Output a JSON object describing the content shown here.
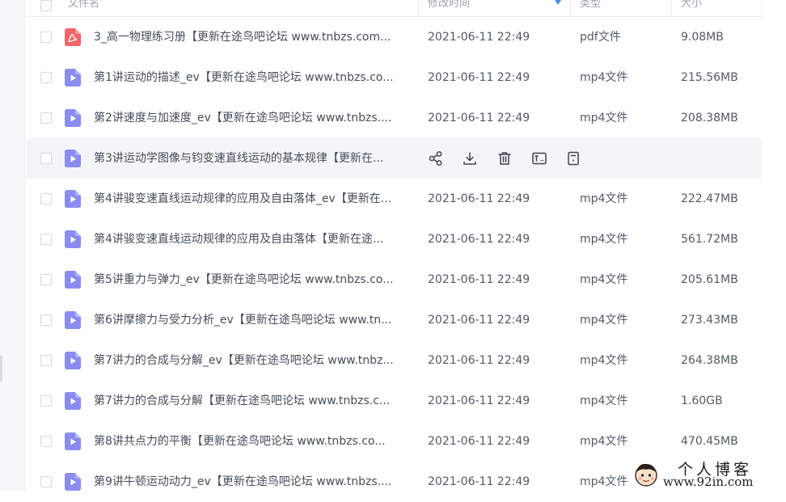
{
  "header": {
    "name_label": "文件名",
    "time_label": "修改时间",
    "type_label": "类型",
    "size_label": "大小"
  },
  "files": [
    {
      "name": "3_高一物理练习册【更新在途鸟吧论坛 www.tnbzs.com...",
      "time": "2021-06-11 22:49",
      "type": "pdf文件",
      "size": "9.08MB",
      "icon": "pdf-icon"
    },
    {
      "name": "第1讲运动的描述_ev【更新在途鸟吧论坛 www.tnbzs.co...",
      "time": "2021-06-11 22:49",
      "type": "mp4文件",
      "size": "215.56MB",
      "icon": "video-file-icon"
    },
    {
      "name": "第2讲速度与加速度_ev【更新在途鸟吧论坛 www.tnbzs....",
      "time": "2021-06-11 22:49",
      "type": "mp4文件",
      "size": "208.38MB",
      "icon": "video-file-icon"
    },
    {
      "name": "第3讲运动学图像与钧变速直线运动的基本规律【更新在...",
      "time": "",
      "type": "",
      "size": "",
      "icon": "video-file-icon",
      "hovered": true
    },
    {
      "name": "第4讲骏变速直线运动规律的应用及自由落体_ev【更新在...",
      "time": "2021-06-11 22:49",
      "type": "mp4文件",
      "size": "222.47MB",
      "icon": "video-file-icon"
    },
    {
      "name": "第4讲骏变速直线运动规律的应用及自由落体【更新在途...",
      "time": "2021-06-11 22:49",
      "type": "mp4文件",
      "size": "561.72MB",
      "icon": "video-file-icon"
    },
    {
      "name": "第5讲重力与弹力_ev【更新在途鸟吧论坛 www.tnbzs.co...",
      "time": "2021-06-11 22:49",
      "type": "mp4文件",
      "size": "205.61MB",
      "icon": "video-file-icon"
    },
    {
      "name": "第6讲摩擦力与受力分析_ev【更新在途鸟吧论坛 www.tn...",
      "time": "2021-06-11 22:49",
      "type": "mp4文件",
      "size": "273.43MB",
      "icon": "video-file-icon"
    },
    {
      "name": "第7讲力的合成与分解_ev【更新在途鸟吧论坛 www.tnbz...",
      "time": "2021-06-11 22:49",
      "type": "mp4文件",
      "size": "264.38MB",
      "icon": "video-file-icon"
    },
    {
      "name": "第7讲力的合成与分解【更新在途鸟吧论坛 www.tnbzs.c...",
      "time": "2021-06-11 22:49",
      "type": "mp4文件",
      "size": "1.60GB",
      "icon": "video-file-icon"
    },
    {
      "name": "第8讲共点力的平衡【更新在途鸟吧论坛 www.tnbzs.co...",
      "time": "2021-06-11 22:49",
      "type": "mp4文件",
      "size": "470.45MB",
      "icon": "video-file-icon"
    },
    {
      "name": "第9讲牛顿运动动力_ev【更新在途鸟吧论坛 www.tnbzs....",
      "time": "2021-06-11 22:49",
      "type": "mp4文件",
      "size": "",
      "icon": "video-file-icon"
    }
  ],
  "row_actions": [
    "share-icon",
    "download-icon",
    "delete-icon",
    "rename-icon",
    "more-icon"
  ],
  "colors": {
    "pdf_icon": "#f06565",
    "video_icon": "#8b8cf2",
    "hover_row": "#f4f5f8",
    "sort_arrow": "#4a8cf7"
  },
  "watermark": {
    "title": "个人博客",
    "url": "www.92in.com"
  }
}
